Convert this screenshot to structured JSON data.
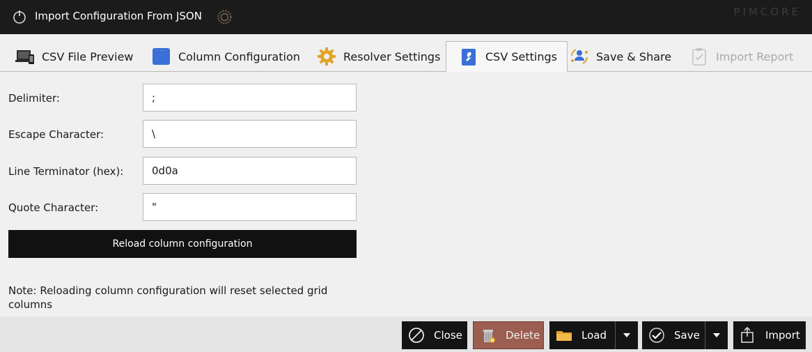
{
  "window": {
    "title": "Import Configuration From JSON",
    "brand": "PIMCORE"
  },
  "tabs": [
    {
      "label": "CSV File Preview",
      "icon": "devices-icon",
      "state": "normal"
    },
    {
      "label": "Column Configuration",
      "icon": "grid-columns-icon",
      "state": "normal"
    },
    {
      "label": "Resolver Settings",
      "icon": "gear-icon",
      "state": "normal"
    },
    {
      "label": "CSV Settings",
      "icon": "wrench-icon",
      "state": "active"
    },
    {
      "label": "Save & Share",
      "icon": "share-users-icon",
      "state": "normal"
    },
    {
      "label": "Import Report",
      "icon": "checklist-icon",
      "state": "disabled"
    }
  ],
  "form": {
    "delimiter_label": "Delimiter:",
    "delimiter_value": ";",
    "escape_label": "Escape Character:",
    "escape_value": "\\",
    "line_terminator_label": "Line Terminator (hex):",
    "line_terminator_value": "0d0a",
    "quote_label": "Quote Character:",
    "quote_value": "\"",
    "reload_label": "Reload column configuration",
    "note": "Note: Reloading column configuration will reset selected grid columns"
  },
  "footer": {
    "close_label": "Close",
    "delete_label": "Delete",
    "load_label": "Load",
    "save_label": "Save",
    "import_label": "Import"
  },
  "colors": {
    "titlebar": "#1b1b1b",
    "button_dark": "#141414",
    "delete_button": "#9b5e50",
    "accent_blue": "#3a6fd8",
    "accent_gold": "#e0a426"
  }
}
